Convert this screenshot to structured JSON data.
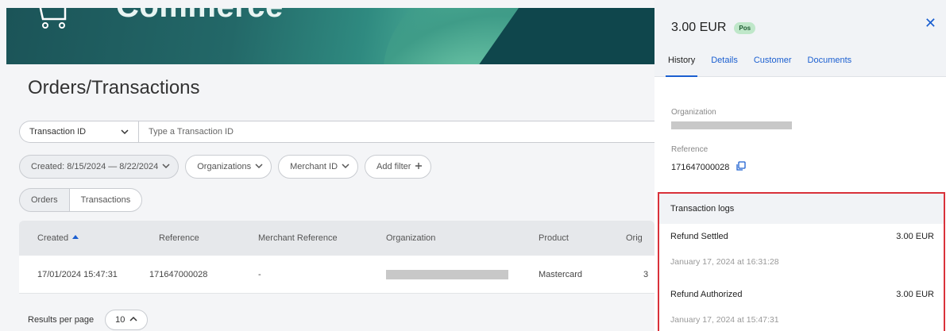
{
  "banner": {
    "title": "Commerce"
  },
  "page": {
    "title": "Orders/Transactions"
  },
  "search": {
    "field_label": "Transaction ID",
    "placeholder": "Type a Transaction ID"
  },
  "filters": {
    "created": "Created: 8/15/2024 — 8/22/2024",
    "organizations": "Organizations",
    "merchant_id": "Merchant ID",
    "add_filter": "Add filter"
  },
  "view_toggle": {
    "orders": "Orders",
    "transactions": "Transactions"
  },
  "table": {
    "headers": {
      "created": "Created",
      "reference": "Reference",
      "merchant_reference": "Merchant Reference",
      "organization": "Organization",
      "product": "Product",
      "orig": "Orig"
    },
    "rows": [
      {
        "created": "17/01/2024 15:47:31",
        "reference": "171647000028",
        "merchant_reference": "-",
        "product": "Mastercard",
        "orig": "3"
      }
    ]
  },
  "pagination": {
    "label": "Results per page",
    "value": "10"
  },
  "panel": {
    "amount": "3.00 EUR",
    "badge": "Pos",
    "tabs": [
      "History",
      "Details",
      "Customer",
      "Documents"
    ],
    "organization_label": "Organization",
    "reference_label": "Reference",
    "reference_value": "171647000028",
    "logs": {
      "title": "Transaction logs",
      "items": [
        {
          "title": "Refund Settled",
          "amount": "3.00 EUR",
          "time": "January 17, 2024 at 16:31:28"
        },
        {
          "title": "Refund Authorized",
          "amount": "3.00 EUR",
          "time": "January 17, 2024 at 15:47:31"
        }
      ]
    }
  },
  "colors": {
    "accent": "#1b5fd0",
    "highlight": "#d9313a",
    "badge_bg": "#bfe7c9"
  }
}
